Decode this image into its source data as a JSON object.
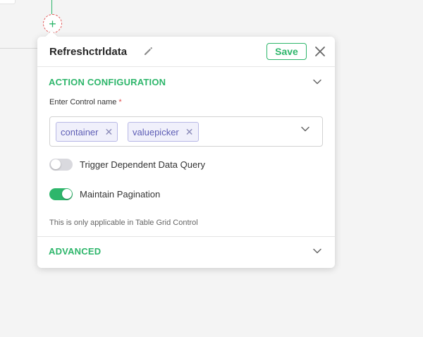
{
  "panel": {
    "title": "Refreshctrldata",
    "save_label": "Save"
  },
  "action_configuration": {
    "section_title": "ACTION CONFIGURATION",
    "control_name_label": "Enter Control name",
    "required_marker": "*",
    "selected_controls": [
      "container",
      "valuepicker"
    ],
    "remove_tag_glyph": "✕"
  },
  "toggles": [
    {
      "label": "Trigger Dependent Data Query",
      "state": "off"
    },
    {
      "label": "Maintain Pagination",
      "state": "on"
    }
  ],
  "hint": "This is only applicable in Table Grid Control",
  "advanced": {
    "section_title": "ADVANCED"
  },
  "canvas": {
    "add_node_glyph": "+"
  },
  "colors": {
    "accent": "#2eb66b",
    "tag_text": "#5d5db5",
    "required": "#e04848"
  },
  "icons": [
    "pencil-icon",
    "close-icon",
    "chevron-down-icon",
    "plus-icon"
  ]
}
